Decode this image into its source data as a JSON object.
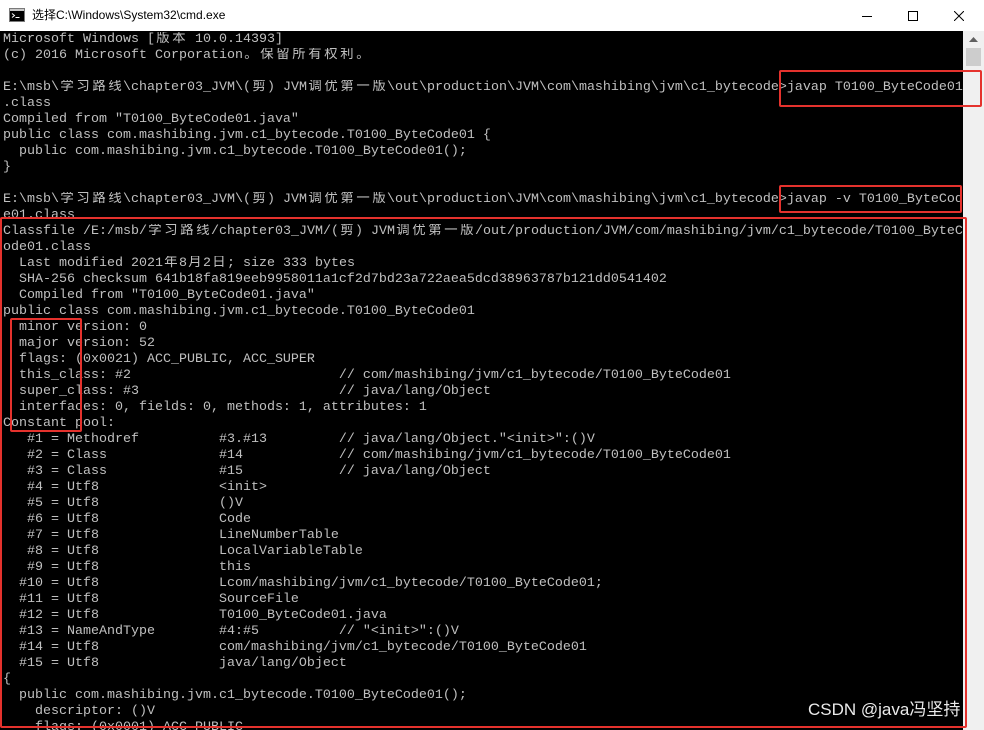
{
  "window": {
    "title": "选择C:\\Windows\\System32\\cmd.exe",
    "icon": "cmd-icon",
    "controls": {
      "minimize": "minimize-icon",
      "maximize": "maximize-icon",
      "close": "close-icon"
    }
  },
  "console": {
    "lines": [
      "Microsoft Windows [版本 10.0.14393]",
      "(c) 2016 Microsoft Corporation。保留所有权利。",
      "",
      "E:\\msb\\学习路线\\chapter03_JVM\\(剪) JVM调优第一版\\out\\production\\JVM\\com\\mashibing\\jvm\\c1_bytecode>javap T0100_ByteCode01",
      ".class",
      "Compiled from \"T0100_ByteCode01.java\"",
      "public class com.mashibing.jvm.c1_bytecode.T0100_ByteCode01 {",
      "  public com.mashibing.jvm.c1_bytecode.T0100_ByteCode01();",
      "}",
      "",
      "E:\\msb\\学习路线\\chapter03_JVM\\(剪) JVM调优第一版\\out\\production\\JVM\\com\\mashibing\\jvm\\c1_bytecode>javap -v T0100_ByteCod",
      "e01.class",
      "Classfile /E:/msb/学习路线/chapter03_JVM/(剪) JVM调优第一版/out/production/JVM/com/mashibing/jvm/c1_bytecode/T0100_ByteC",
      "ode01.class",
      "  Last modified 2021年8月2日; size 333 bytes",
      "  SHA-256 checksum 641b18fa819eeb9958011a1cf2d7bd23a722aea5dcd38963787b121dd0541402",
      "  Compiled from \"T0100_ByteCode01.java\"",
      "public class com.mashibing.jvm.c1_bytecode.T0100_ByteCode01",
      "  minor version: 0",
      "  major version: 52",
      "  flags: (0x0021) ACC_PUBLIC, ACC_SUPER",
      "  this_class: #2                          // com/mashibing/jvm/c1_bytecode/T0100_ByteCode01",
      "  super_class: #3                         // java/lang/Object",
      "  interfaces: 0, fields: 0, methods: 1, attributes: 1",
      "Constant pool:",
      "   #1 = Methodref          #3.#13         // java/lang/Object.\"<init>\":()V",
      "   #2 = Class              #14            // com/mashibing/jvm/c1_bytecode/T0100_ByteCode01",
      "   #3 = Class              #15            // java/lang/Object",
      "   #4 = Utf8               <init>",
      "   #5 = Utf8               ()V",
      "   #6 = Utf8               Code",
      "   #7 = Utf8               LineNumberTable",
      "   #8 = Utf8               LocalVariableTable",
      "   #9 = Utf8               this",
      "  #10 = Utf8               Lcom/mashibing/jvm/c1_bytecode/T0100_ByteCode01;",
      "  #11 = Utf8               SourceFile",
      "  #12 = Utf8               T0100_ByteCode01.java",
      "  #13 = NameAndType        #4:#5          // \"<init>\":()V",
      "  #14 = Utf8               com/mashibing/jvm/c1_bytecode/T0100_ByteCode01",
      "  #15 = Utf8               java/lang/Object",
      "{",
      "  public com.mashibing.jvm.c1_bytecode.T0100_ByteCode01();",
      "    descriptor: ()V",
      "    flags: (0x0001) ACC_PUBLIC"
    ]
  },
  "scrollbar": {
    "up_arrow": "chevron-up-icon"
  },
  "watermark": "CSDN @java冯坚持",
  "colors": {
    "titlebar_bg": "#ffffff",
    "console_bg": "#000000",
    "console_fg": "#c0c0c0",
    "scrollbar_bg": "#f0f0f0",
    "scrollbar_thumb": "#cdcdcd",
    "annotation": "#e5322d"
  }
}
